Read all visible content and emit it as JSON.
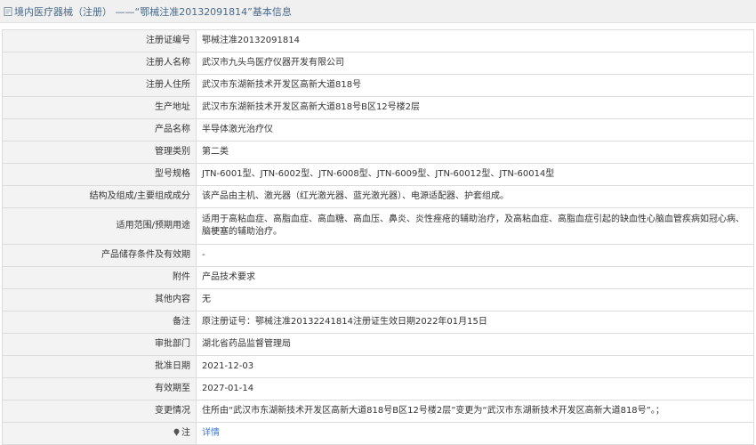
{
  "header": {
    "title": "境内医疗器械（注册） ——“鄂械注准20132091814”基本信息"
  },
  "rows": [
    {
      "label": "注册证编号",
      "value": "鄂械注准20132091814"
    },
    {
      "label": "注册人名称",
      "value": "武汉市九头鸟医疗仪器开发有限公司"
    },
    {
      "label": "注册人住所",
      "value": "武汉市东湖新技术开发区高新大道818号"
    },
    {
      "label": "生产地址",
      "value": "武汉市东湖新技术开发区高新大道818号B区12号楼2层"
    },
    {
      "label": "产品名称",
      "value": "半导体激光治疗仪"
    },
    {
      "label": "管理类别",
      "value": "第二类"
    },
    {
      "label": "型号规格",
      "value": "JTN-6001型、JTN-6002型、JTN-6008型、JTN-6009型、JTN-60012型、JTN-60014型"
    },
    {
      "label": "结构及组成/主要组成成分",
      "value": "该产品由主机、激光器（红光激光器、蓝光激光器）、电源适配器、护套组成。"
    },
    {
      "label": "适用范围/预期用途",
      "value": "适用于高粘血症、高脂血症、高血糖、高血压、鼻炎、炎性痤疮的辅助治疗，及高粘血症、高脂血症引起的缺血性心脑血管疾病如冠心病、脑梗塞的辅助治疗。"
    },
    {
      "label": "产品储存条件及有效期",
      "value": "-"
    },
    {
      "label": "附件",
      "value": "产品技术要求"
    },
    {
      "label": "其他内容",
      "value": "无"
    },
    {
      "label": "备注",
      "value": "原注册证号：鄂械注准20132241814注册证生效日期2022年01月15日"
    },
    {
      "label": "审批部门",
      "value": "湖北省药品监督管理局"
    },
    {
      "label": "批准日期",
      "value": "2021-12-03"
    },
    {
      "label": "有效期至",
      "value": "2027-01-14"
    },
    {
      "label": "变更情况",
      "value": "住所由“武汉市东湖新技术开发区高新大道818号B区12号楼2层”变更为“武汉市东湖新技术开发区高新大道818号”。；"
    }
  ],
  "note": {
    "label": "注",
    "link_text": "详情"
  }
}
